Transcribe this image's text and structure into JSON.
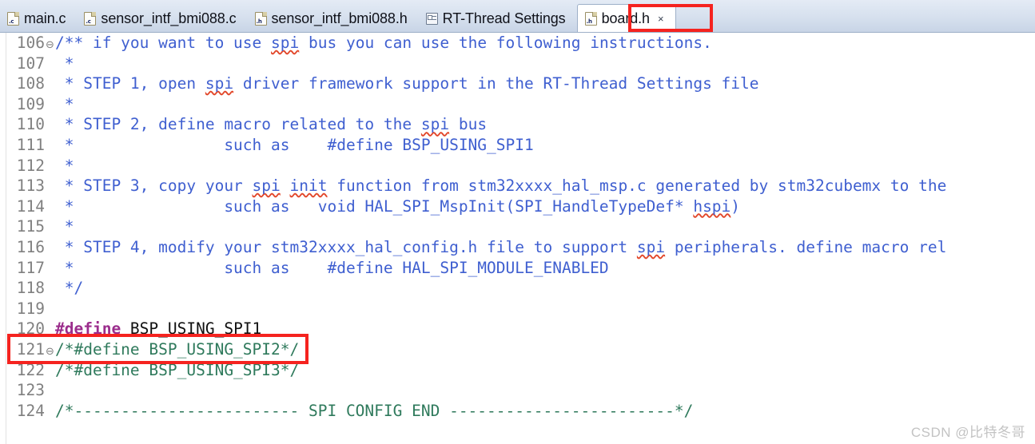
{
  "tabbar": {
    "tabs": [
      {
        "label": "main.c",
        "icon": "c-file-icon",
        "ext": ".c",
        "active": false
      },
      {
        "label": "sensor_intf_bmi088.c",
        "icon": "c-file-icon",
        "ext": ".c",
        "active": false
      },
      {
        "label": "sensor_intf_bmi088.h",
        "icon": "h-file-icon",
        "ext": ".h",
        "active": false
      },
      {
        "label": "RT-Thread Settings",
        "icon": "settings-icon",
        "ext": "",
        "active": false
      },
      {
        "label": "board.h",
        "icon": "h-file-icon",
        "ext": ".h",
        "active": true,
        "close_label": "×"
      }
    ]
  },
  "editor": {
    "lines": [
      {
        "no": "106",
        "fold": "⊖",
        "segments": [
          {
            "text": "/** if you want to use ",
            "style": "cmt-blue"
          },
          {
            "text": "spi",
            "style": "cmt-blue spell"
          },
          {
            "text": " bus you can use the following instructions.",
            "style": "cmt-blue"
          }
        ]
      },
      {
        "no": "107",
        "fold": "",
        "segments": [
          {
            "text": " *",
            "style": "cmt-blue"
          }
        ]
      },
      {
        "no": "108",
        "fold": "",
        "segments": [
          {
            "text": " * STEP 1, open ",
            "style": "cmt-blue"
          },
          {
            "text": "spi",
            "style": "cmt-blue spell"
          },
          {
            "text": " driver framework support in the RT-Thread Settings file",
            "style": "cmt-blue"
          }
        ]
      },
      {
        "no": "109",
        "fold": "",
        "segments": [
          {
            "text": " *",
            "style": "cmt-blue"
          }
        ]
      },
      {
        "no": "110",
        "fold": "",
        "segments": [
          {
            "text": " * STEP 2, define macro related to the ",
            "style": "cmt-blue"
          },
          {
            "text": "spi",
            "style": "cmt-blue spell"
          },
          {
            "text": " bus",
            "style": "cmt-blue"
          }
        ]
      },
      {
        "no": "111",
        "fold": "",
        "segments": [
          {
            "text": " *                such as    #define BSP_USING_SPI1",
            "style": "cmt-blue"
          }
        ]
      },
      {
        "no": "112",
        "fold": "",
        "segments": [
          {
            "text": " *",
            "style": "cmt-blue"
          }
        ]
      },
      {
        "no": "113",
        "fold": "",
        "segments": [
          {
            "text": " * STEP 3, copy your ",
            "style": "cmt-blue"
          },
          {
            "text": "spi",
            "style": "cmt-blue spell"
          },
          {
            "text": " ",
            "style": "cmt-blue"
          },
          {
            "text": "init",
            "style": "cmt-blue spell"
          },
          {
            "text": " function from stm32xxxx_hal_msp.c generated by stm32cubemx to the",
            "style": "cmt-blue"
          }
        ]
      },
      {
        "no": "114",
        "fold": "",
        "segments": [
          {
            "text": " *                such as   void HAL_SPI_MspInit(SPI_HandleTypeDef* ",
            "style": "cmt-blue"
          },
          {
            "text": "hspi",
            "style": "cmt-blue spell"
          },
          {
            "text": ")",
            "style": "cmt-blue"
          }
        ]
      },
      {
        "no": "115",
        "fold": "",
        "segments": [
          {
            "text": " *",
            "style": "cmt-blue"
          }
        ]
      },
      {
        "no": "116",
        "fold": "",
        "segments": [
          {
            "text": " * STEP 4, modify your stm32xxxx_hal_config.h file to support ",
            "style": "cmt-blue"
          },
          {
            "text": "spi",
            "style": "cmt-blue spell"
          },
          {
            "text": " peripherals. define macro rel",
            "style": "cmt-blue"
          }
        ]
      },
      {
        "no": "117",
        "fold": "",
        "segments": [
          {
            "text": " *                such as    #define HAL_SPI_MODULE_ENABLED",
            "style": "cmt-blue"
          }
        ]
      },
      {
        "no": "118",
        "fold": "",
        "segments": [
          {
            "text": " */",
            "style": "cmt-blue"
          }
        ]
      },
      {
        "no": "119",
        "fold": "",
        "segments": [
          {
            "text": "",
            "style": "plain"
          }
        ]
      },
      {
        "no": "120",
        "fold": "",
        "segments": [
          {
            "text": "#define",
            "style": "pp"
          },
          {
            "text": " BSP_USING_SPI1",
            "style": "plain"
          }
        ]
      },
      {
        "no": "121",
        "fold": "⊖",
        "segments": [
          {
            "text": "/*#define BSP_USING_SPI2*/",
            "style": "cmt-green"
          }
        ]
      },
      {
        "no": "122",
        "fold": "",
        "segments": [
          {
            "text": "/*#define BSP_USING_SPI3*/",
            "style": "cmt-green"
          }
        ]
      },
      {
        "no": "123",
        "fold": "",
        "segments": [
          {
            "text": "",
            "style": "plain"
          }
        ]
      },
      {
        "no": "124",
        "fold": "",
        "segments": [
          {
            "text": "/*------------------------ SPI CONFIG END ------------------------*/",
            "style": "cmt-green"
          }
        ]
      }
    ]
  },
  "annotations": {
    "highlight_color": "#f5231f",
    "tab_highlight_target": "board.h",
    "line_highlight_target": "120"
  },
  "watermark": {
    "text": "CSDN @比特冬哥"
  }
}
